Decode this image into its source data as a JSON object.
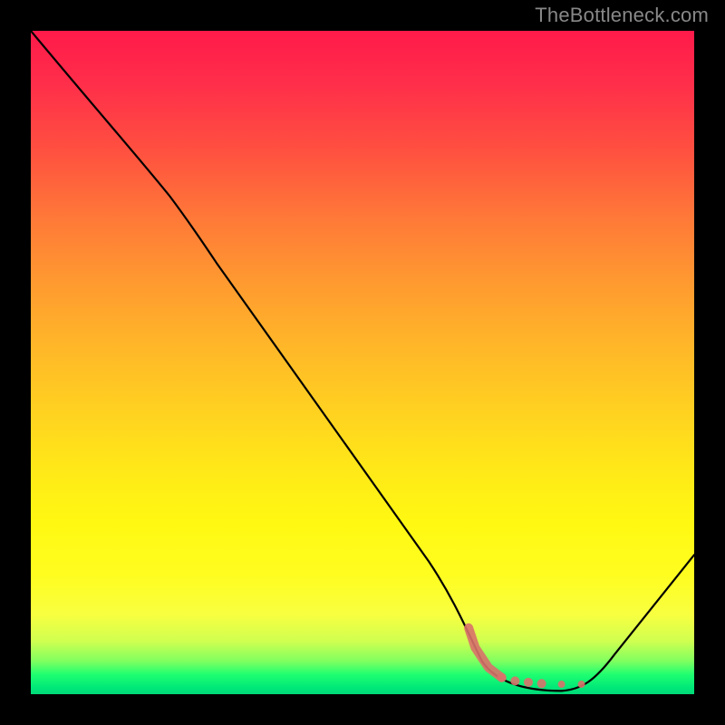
{
  "attribution": "TheBottleneck.com",
  "chart_data": {
    "type": "line",
    "title": "",
    "xlabel": "",
    "ylabel": "",
    "xlim": [
      0,
      100
    ],
    "ylim": [
      0,
      100
    ],
    "series": [
      {
        "name": "main-curve",
        "color": "#000000",
        "points": [
          {
            "x": 0,
            "y": 100
          },
          {
            "x": 20,
            "y": 76
          },
          {
            "x": 26,
            "y": 68
          },
          {
            "x": 62,
            "y": 18
          },
          {
            "x": 68,
            "y": 6
          },
          {
            "x": 74,
            "y": 1.5
          },
          {
            "x": 80,
            "y": 0.5
          },
          {
            "x": 84,
            "y": 1
          },
          {
            "x": 100,
            "y": 21
          }
        ]
      },
      {
        "name": "highlighted-segment",
        "color": "#d9716a",
        "points": [
          {
            "x": 66,
            "y": 10
          },
          {
            "x": 67,
            "y": 7
          },
          {
            "x": 69,
            "y": 4
          },
          {
            "x": 71,
            "y": 2.5
          },
          {
            "x": 73,
            "y": 2
          },
          {
            "x": 75,
            "y": 1.8
          },
          {
            "x": 77,
            "y": 1.6
          },
          {
            "x": 80,
            "y": 1.5
          },
          {
            "x": 83,
            "y": 1.5
          }
        ]
      }
    ]
  }
}
